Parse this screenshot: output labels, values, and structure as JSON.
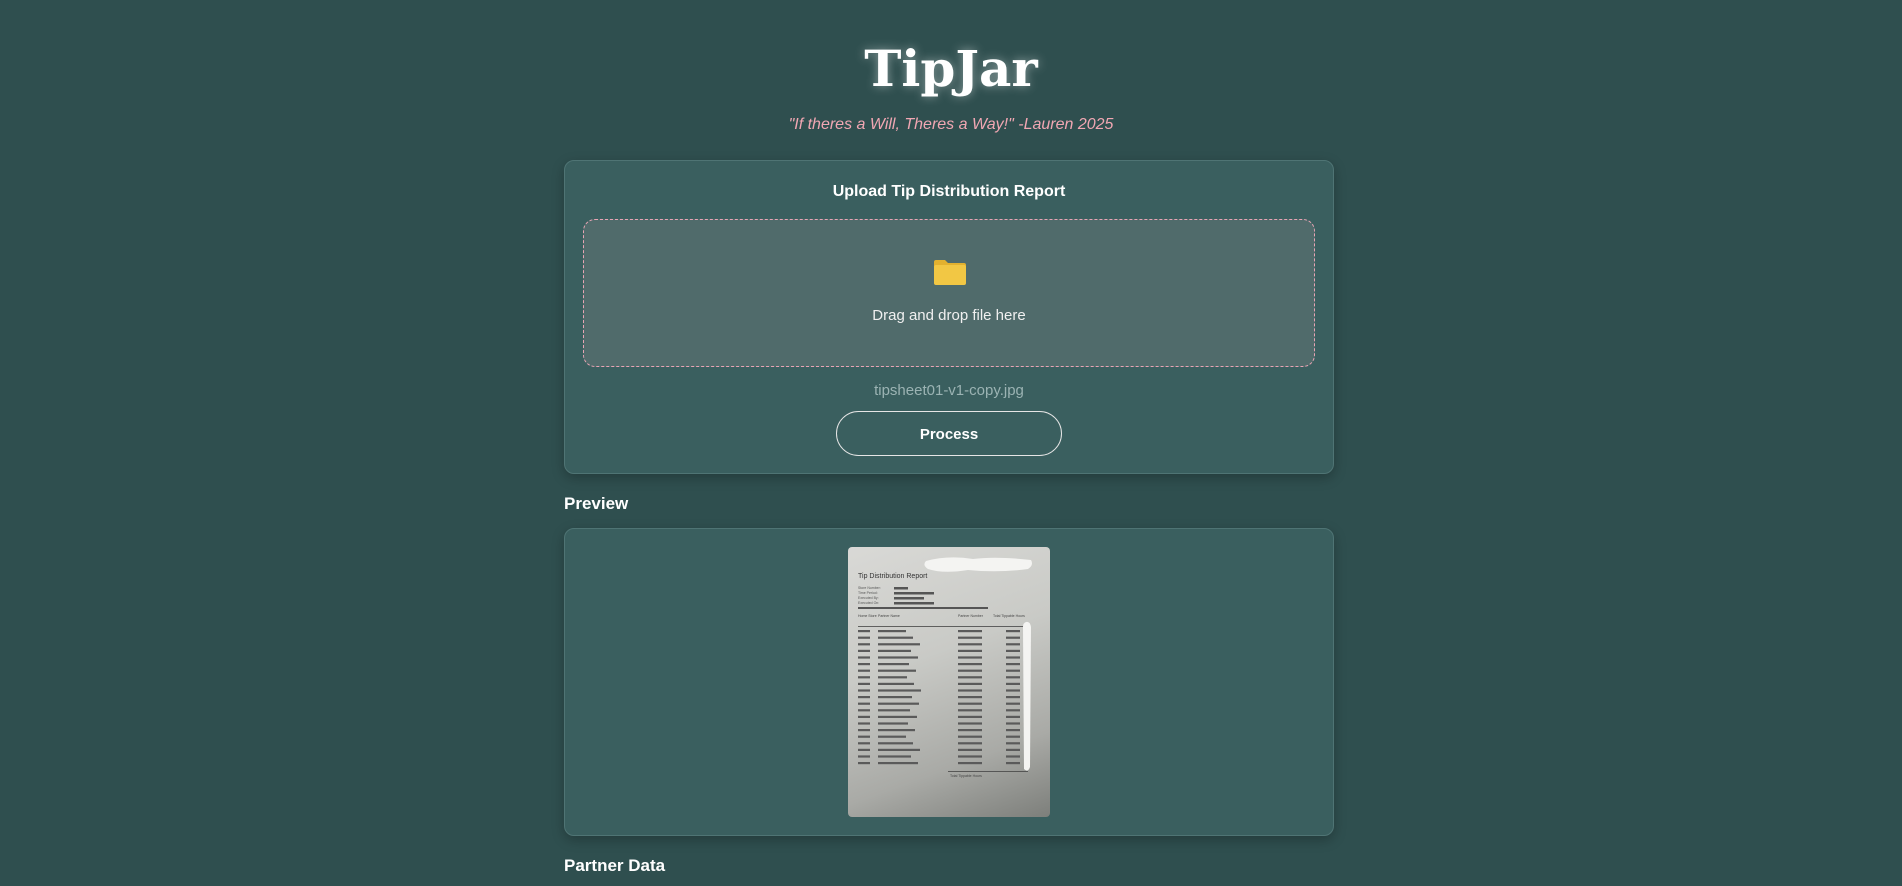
{
  "app": {
    "title": "TipJar",
    "tagline": "\"If theres a Will, Theres a Way!\" -Lauren 2025"
  },
  "upload": {
    "heading": "Upload Tip Distribution Report",
    "dropzone_icon": "folder-icon",
    "dropzone_text": "Drag and drop file here",
    "file_name": "tipsheet01-v1-copy.jpg",
    "process_label": "Process"
  },
  "preview": {
    "label": "Preview",
    "image": {
      "report_title": "Tip Distribution Report",
      "header_lines": [
        "Store Number:",
        "Time Period:",
        "Executed By:",
        "Executed On:"
      ],
      "column_headers": [
        "Home Store",
        "Partner Name",
        "Partner Number",
        "Total Tippable Hours"
      ],
      "total_label": "Total Tippable Hours"
    }
  },
  "partner_data": {
    "label": "Partner Data"
  },
  "colors": {
    "background": "#2f4f4f",
    "card": "#3a5f5f",
    "tagline": "#f1a7b3",
    "dropzone_border": "#e8a4b4",
    "folder": "#f2c744"
  }
}
